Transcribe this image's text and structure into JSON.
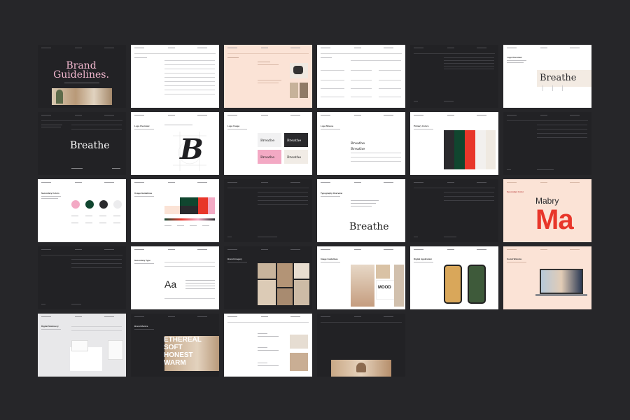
{
  "pages": {
    "p01": {
      "title": "Brand Guidelines."
    },
    "p06": {
      "section": "Logo Overview",
      "wordmark": "Breathe"
    },
    "p07": {
      "wordmark": "Breathe"
    },
    "p08": {
      "section": "Logo Overview",
      "symbol": "B"
    },
    "p09": {
      "section": "Logo Usage",
      "wordmark": "Breathe"
    },
    "p10": {
      "section": "Logo Misuse",
      "wordmark": "Breathe"
    },
    "p11": {
      "section": "Primary Colors"
    },
    "p13": {
      "section": "Secondary Colors"
    },
    "p14": {
      "section": "Usage Guidelines"
    },
    "p16": {
      "section": "Typography Overview",
      "wordmark": "Breathe"
    },
    "p18": {
      "section": "Secondary Color",
      "font_name": "Mabry",
      "glyphs": "Ma"
    },
    "p20": {
      "section": "Secondary Type",
      "sample": "Aa"
    },
    "p21": {
      "section": "Brand Imagery"
    },
    "p22": {
      "section": "Image Guidelines",
      "mood": "MOOD"
    },
    "p23": {
      "section": "Digital Application"
    },
    "p24": {
      "section": "Social Website"
    },
    "p25": {
      "section": "Digital Stationery"
    },
    "p26": {
      "section": "Brand Mantra",
      "mantra": [
        "ETHEREAL",
        "SOFT",
        "HONEST",
        "WARM"
      ]
    }
  },
  "colors": {
    "background": "#262629",
    "dark_page": "#222225",
    "peach": "#fbe3d6",
    "pink": "#f3a9c4",
    "green": "#10462f",
    "red": "#e8362a",
    "charcoal": "#2a2a2d",
    "cream": "#efe9e1"
  }
}
